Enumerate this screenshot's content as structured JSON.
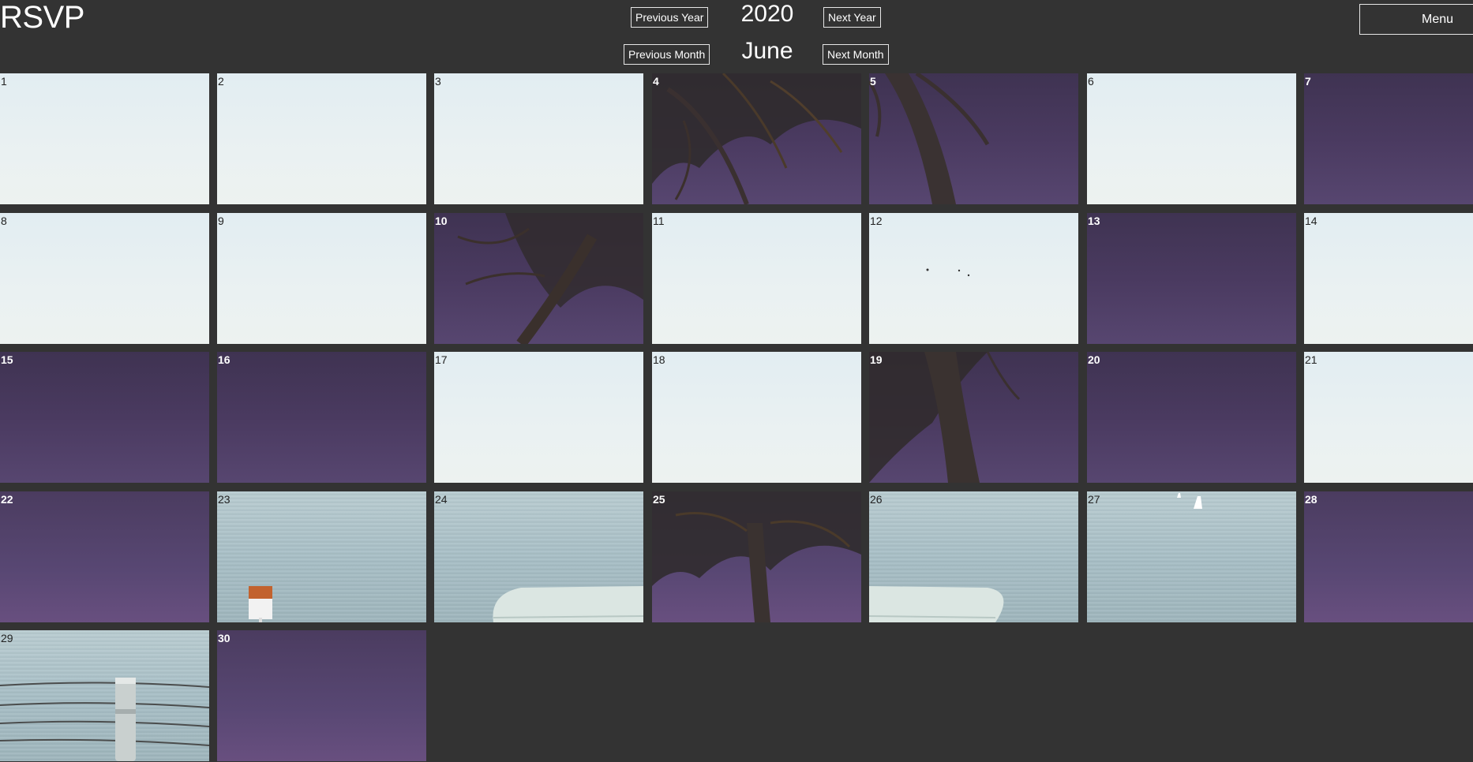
{
  "header": {
    "brand": "RSVP",
    "year": "2020",
    "month": "June",
    "prev_year_label": "Previous Year",
    "next_year_label": "Next Year",
    "prev_month_label": "Previous Month",
    "next_month_label": "Next Month",
    "menu_label": "Menu"
  },
  "calendar": {
    "days": [
      "1",
      "2",
      "3",
      "4",
      "5",
      "6",
      "7",
      "8",
      "9",
      "10",
      "11",
      "12",
      "13",
      "14",
      "15",
      "16",
      "17",
      "18",
      "19",
      "20",
      "21",
      "22",
      "23",
      "24",
      "25",
      "26",
      "27",
      "28",
      "29",
      "30"
    ]
  },
  "colors": {
    "background": "#333333",
    "sky": "#e6eff2",
    "purple": "#4a3a60",
    "sea": "#a8bfc6"
  }
}
